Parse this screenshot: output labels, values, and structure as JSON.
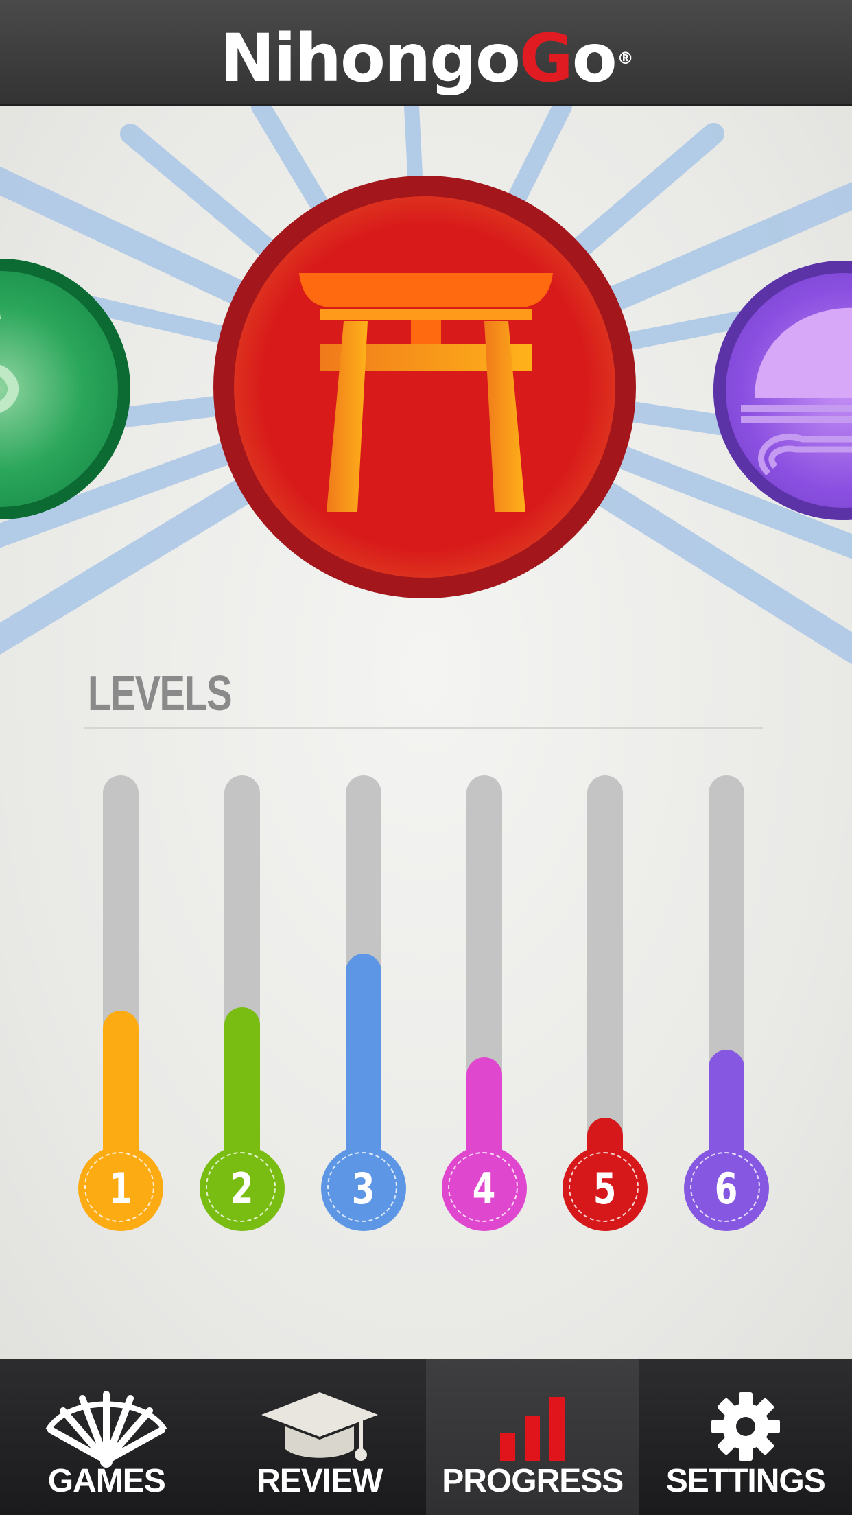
{
  "header": {
    "logo_main": "Nihongo",
    "logo_accent_1": "G",
    "logo_accent_2": "o",
    "logo_mark": "®"
  },
  "badges": [
    {
      "name": "green-level-badge",
      "icon": "swirl-icon",
      "color": "#1f9a50"
    },
    {
      "name": "red-level-badge",
      "icon": "torii-gate-icon",
      "color": "#d81a1a"
    },
    {
      "name": "purple-level-badge",
      "icon": "wave-fan-icon",
      "color": "#8a4fe0"
    }
  ],
  "levels_section": {
    "title": "LEVELS",
    "levels": [
      {
        "number": "1",
        "progress": 0.34,
        "color": "#fdab13"
      },
      {
        "number": "2",
        "progress": 0.35,
        "color": "#7abd12"
      },
      {
        "number": "3",
        "progress": 0.5,
        "color": "#5d96e4"
      },
      {
        "number": "4",
        "progress": 0.21,
        "color": "#e047cf"
      },
      {
        "number": "5",
        "progress": 0.04,
        "color": "#d6181b"
      },
      {
        "number": "6",
        "progress": 0.23,
        "color": "#8658e2"
      }
    ]
  },
  "tabbar": {
    "tabs": [
      {
        "label": "GAMES",
        "icon": "fan-icon",
        "active": false
      },
      {
        "label": "REVIEW",
        "icon": "graduation-cap-icon",
        "active": false
      },
      {
        "label": "PROGRESS",
        "icon": "bar-chart-icon",
        "active": true
      },
      {
        "label": "SETTINGS",
        "icon": "gear-icon",
        "active": false
      }
    ]
  }
}
